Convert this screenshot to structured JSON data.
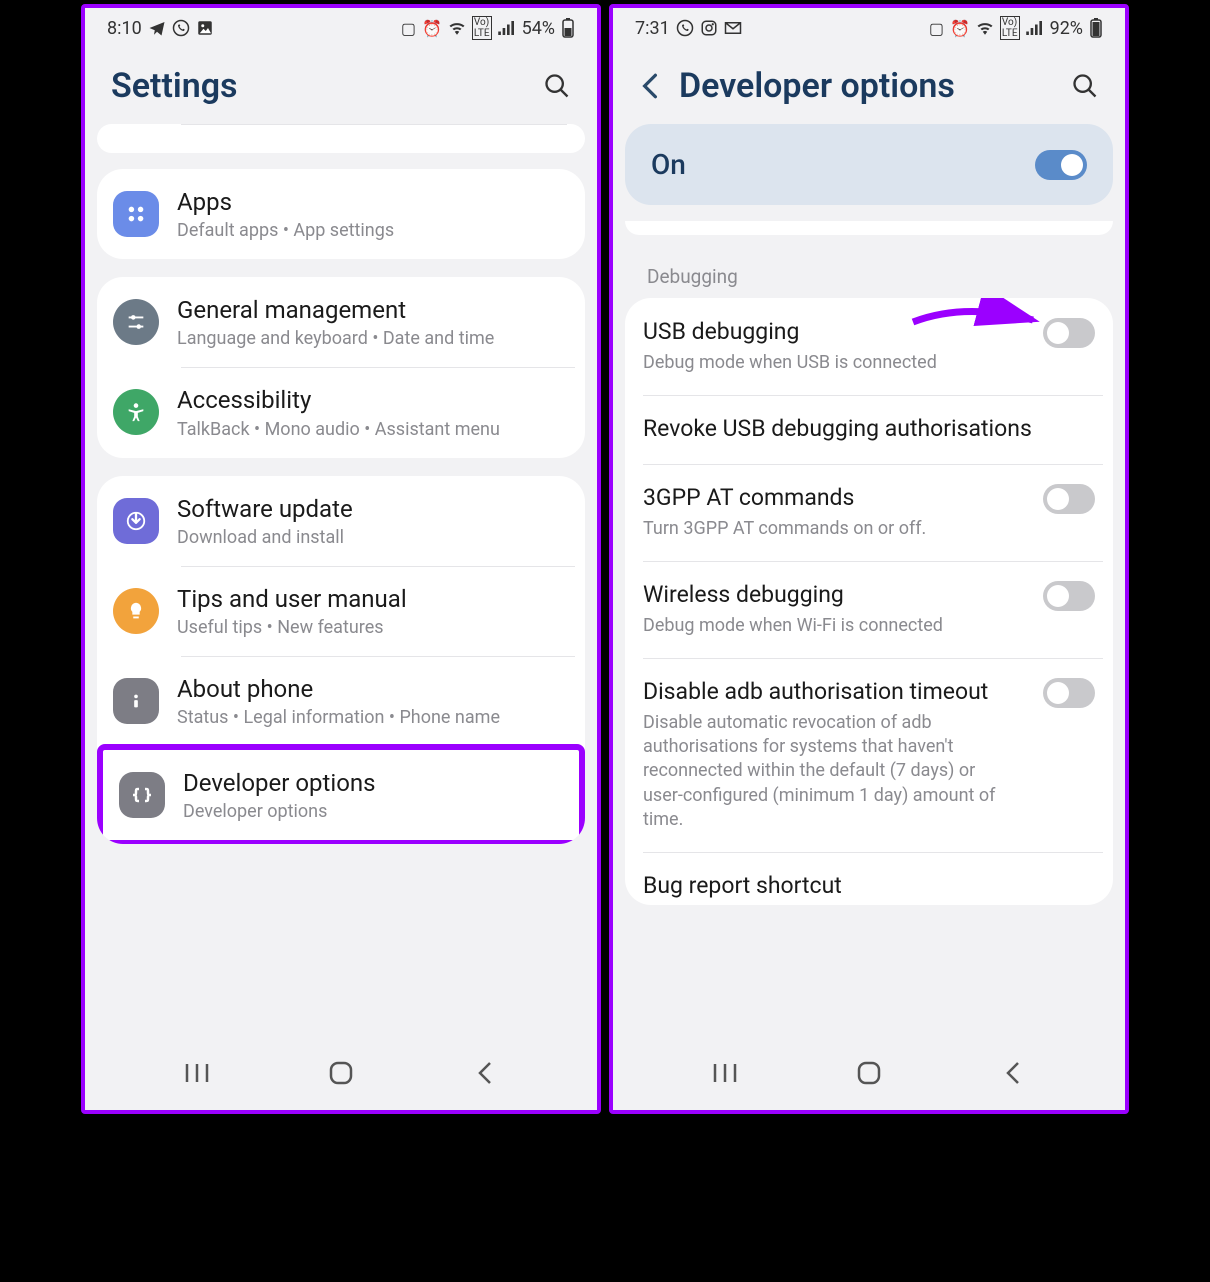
{
  "left_phone": {
    "status": {
      "time": "8:10",
      "battery": "54%"
    },
    "title": "Settings",
    "groups": [
      {
        "items": [
          {
            "icon": "apps",
            "title": "Apps",
            "sub": "Default apps  •  App settings"
          }
        ]
      },
      {
        "items": [
          {
            "icon": "general",
            "title": "General management",
            "sub": "Language and keyboard  •  Date and time"
          },
          {
            "icon": "accessibility",
            "title": "Accessibility",
            "sub": "TalkBack  •  Mono audio  •  Assistant menu"
          }
        ]
      },
      {
        "items": [
          {
            "icon": "update",
            "title": "Software update",
            "sub": "Download and install"
          },
          {
            "icon": "tips",
            "title": "Tips and user manual",
            "sub": "Useful tips  •  New features"
          },
          {
            "icon": "about",
            "title": "About phone",
            "sub": "Status  •  Legal information  •  Phone name"
          },
          {
            "icon": "dev",
            "title": "Developer options",
            "sub": "Developer options",
            "highlighted": true
          }
        ]
      }
    ]
  },
  "right_phone": {
    "status": {
      "time": "7:31",
      "battery": "92%"
    },
    "title": "Developer options",
    "master_label": "On",
    "section_label": "Debugging",
    "items": [
      {
        "title": "USB debugging",
        "sub": "Debug mode when USB is connected",
        "toggle": "off",
        "arrow": true
      },
      {
        "title": "Revoke USB debugging authorisations",
        "sub": ""
      },
      {
        "title": "3GPP AT commands",
        "sub": "Turn 3GPP AT commands on or off.",
        "toggle": "off"
      },
      {
        "title": "Wireless debugging",
        "sub": "Debug mode when Wi-Fi is connected",
        "toggle": "off"
      },
      {
        "title": "Disable adb authorisation timeout",
        "sub": "Disable automatic revocation of adb authorisations for systems that haven't reconnected within the default (7 days) or user-configured (minimum 1 day) amount of time.",
        "toggle": "off"
      },
      {
        "title": "Bug report shortcut",
        "sub": ""
      }
    ]
  },
  "icon_colors": {
    "apps": "#6b8ce8",
    "general": "#6c7a87",
    "accessibility": "#3fa767",
    "update": "#6f6cd8",
    "tips": "#f2a33c",
    "about": "#7d7d85",
    "dev": "#7d7d85"
  }
}
